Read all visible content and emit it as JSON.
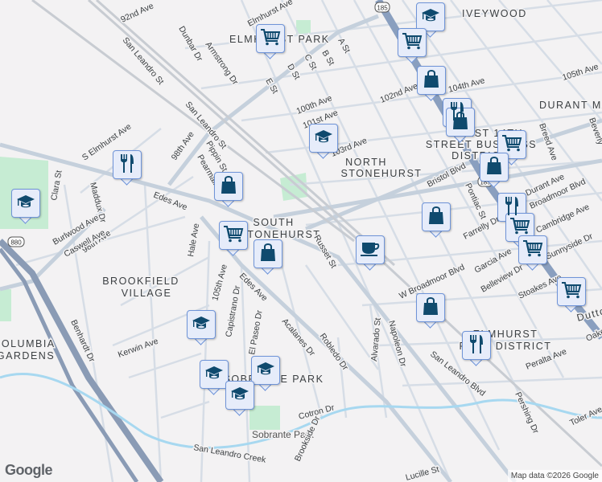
{
  "map": {
    "neighborhoods": [
      "ELMHURST PARK",
      "IVEYWOOD",
      "DURANT MA",
      "NORTH",
      "STONEHURST",
      "SOUTH",
      "STONEHURST",
      "BROOKFIELD",
      "VILLAGE",
      "COLUMBIA",
      "GARDENS",
      "EAST 14TH",
      "STREET BUSINESS",
      "DISTRICT",
      "ELMHURST",
      "PORT DISTRICT",
      "SOBRANTE PARK"
    ],
    "parks": [
      "Sobrante Park",
      "San Leandro Creek"
    ],
    "streets": [
      "92nd Ave",
      "San Leandro St",
      "San Leandro St",
      "Dunbar Dr",
      "Armstrong Dr",
      "Elmhurst Ave",
      "A St",
      "B St",
      "C St",
      "D St",
      "E St",
      "100th Ave",
      "101st Ave",
      "102nd Ave",
      "103rd Ave",
      "104th Ave",
      "105th Ave",
      "S Elmhurst Ave",
      "98th Ave",
      "98th Ave",
      "Pippin St",
      "Pearmain St",
      "Edes Ave",
      "Edes Ave",
      "Clara St",
      "Maddux Dr",
      "Burlwood Ave",
      "Caswell Ave",
      "Hale Ave",
      "105th Ave",
      "Capistrano Dr",
      "El Paseo Dr",
      "Acalanes Dr",
      "Robledo Dr",
      "Russet St",
      "Bristol Blvd",
      "Pontiac St",
      "Farrelly Dr",
      "W Broadmoor Blvd",
      "Garcia Ave",
      "Belleview Dr",
      "Stoakes Ave",
      "Alvarado St",
      "Napoleon Dr",
      "San Leandro Blvd",
      "Peralta Ave",
      "Pershing Dr",
      "Breed Ave",
      "Beverly",
      "Durant Ave",
      "Broadmoor Blvd",
      "Cambridge Ave",
      "Sunnyside Dr",
      "Cotron Dr",
      "Brookside Dr",
      "Lucille St",
      "Kerwin Ave",
      "Benhardt Dr",
      "Toler Ave",
      "Oakes",
      "Dutton"
    ],
    "shields": [
      "185",
      "185",
      "880"
    ],
    "markers": [
      "school",
      "cart",
      "cart",
      "bag",
      "restaurant",
      "bag",
      "school",
      "restaurant",
      "bag",
      "school",
      "cart",
      "bag",
      "restaurant",
      "cart",
      "bag",
      "cart",
      "bag",
      "coffee",
      "cart",
      "cart",
      "bag",
      "restaurant",
      "school",
      "school",
      "school",
      "school"
    ]
  },
  "logo": "Google",
  "attribution": "Map data ©2026 Google"
}
